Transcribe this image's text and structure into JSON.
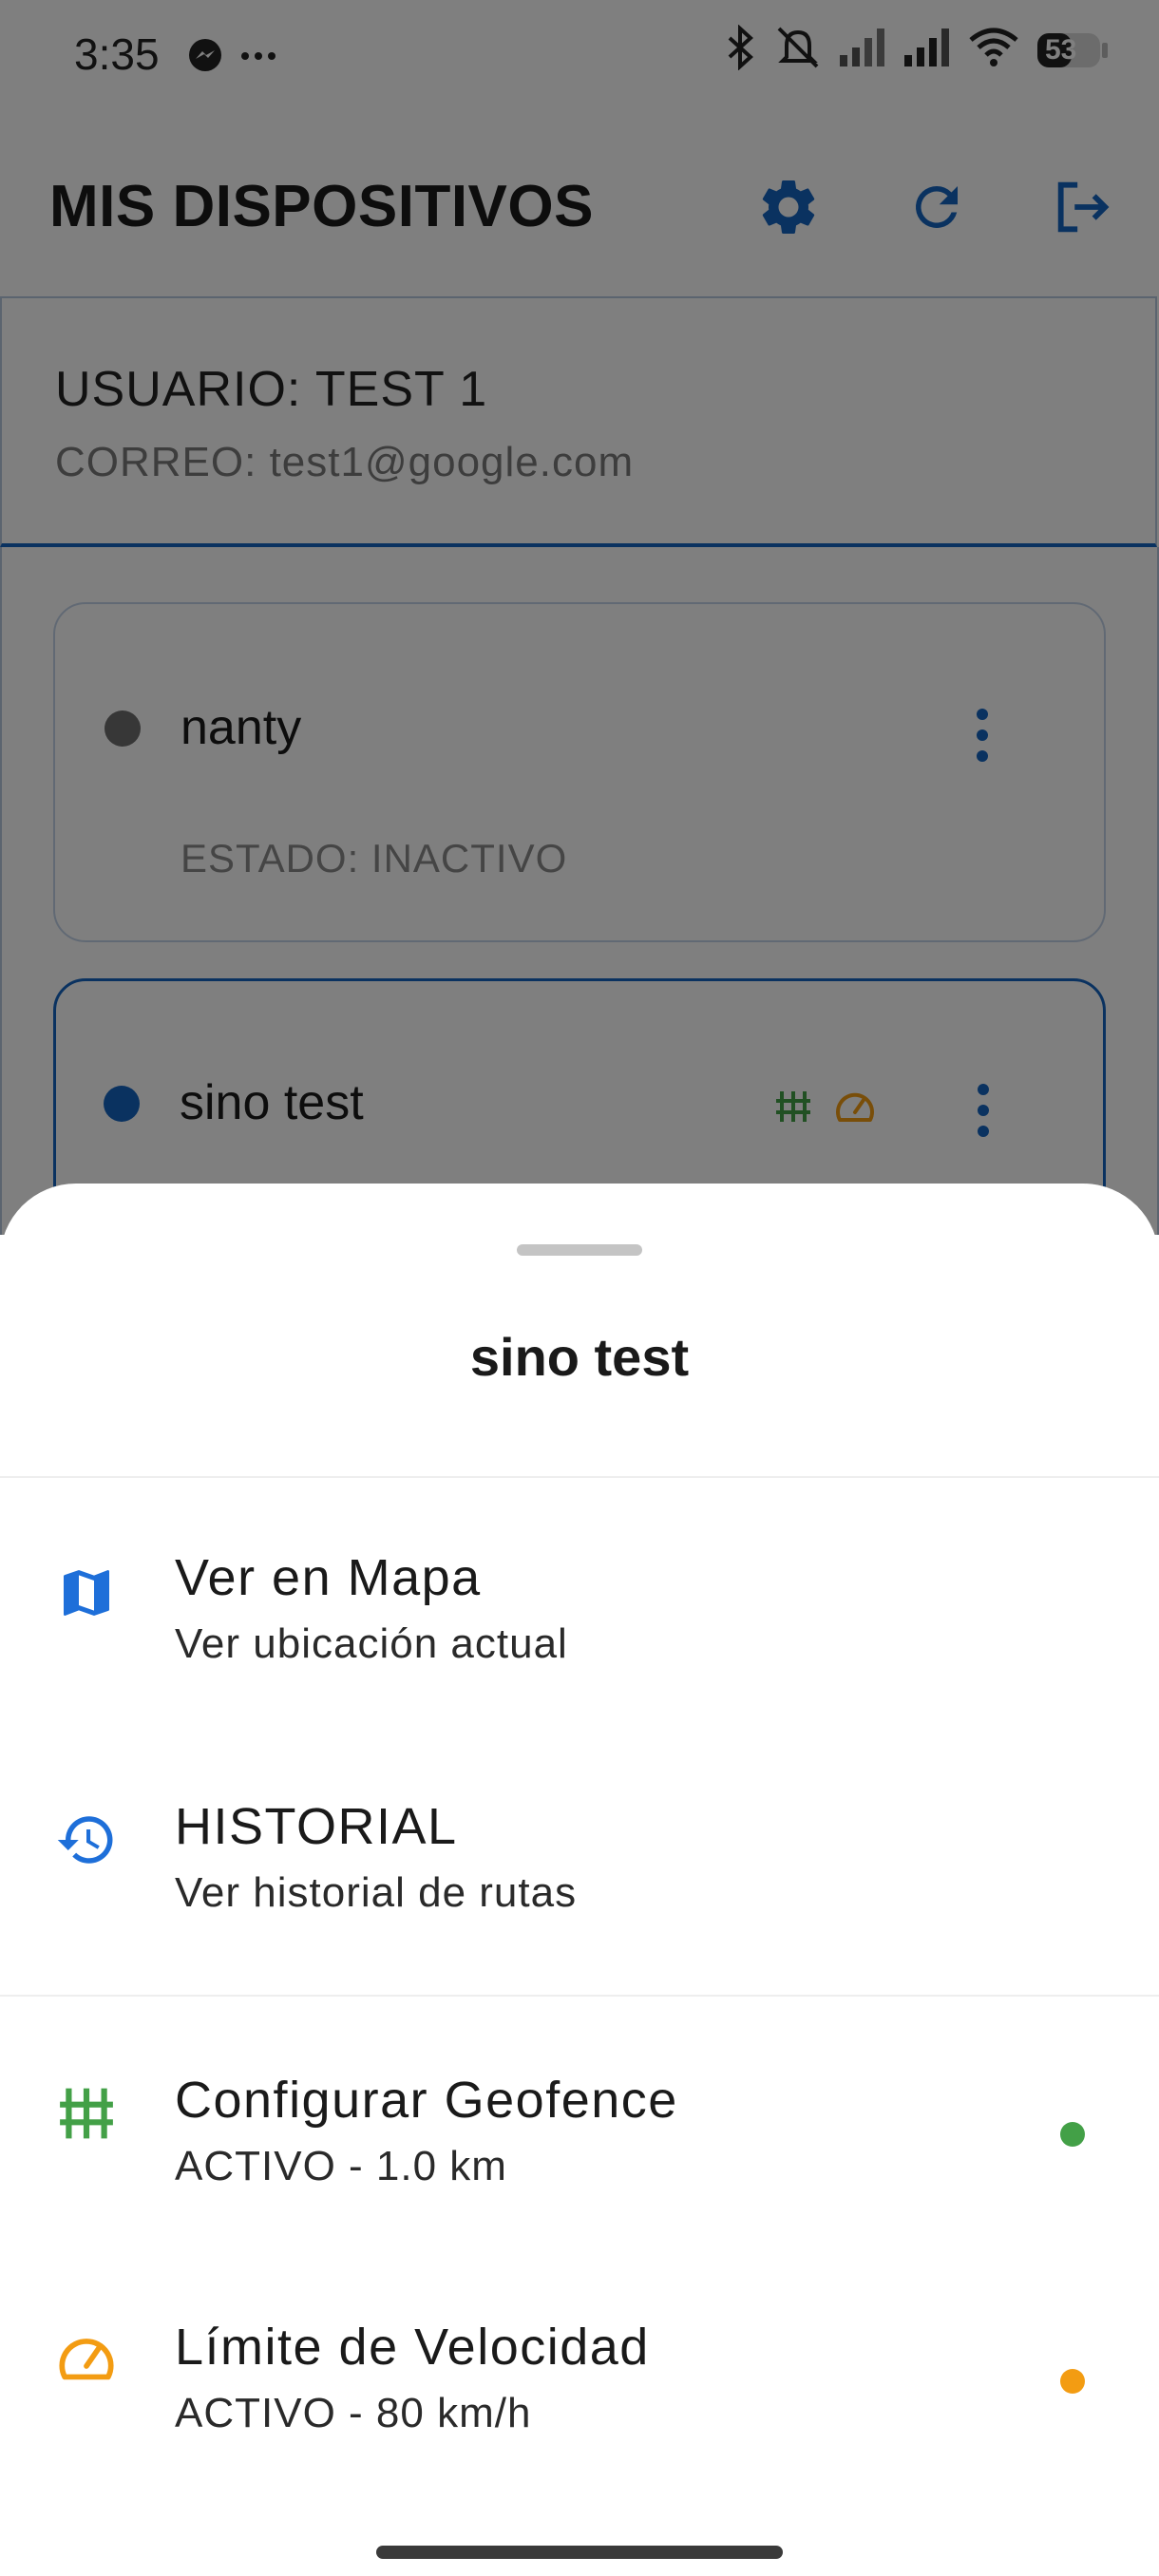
{
  "status_bar": {
    "time": "3:35",
    "battery": "53",
    "icons": [
      "messenger-icon",
      "more-dots-icon",
      "bluetooth-icon",
      "bell-off-icon",
      "signal-icon",
      "signal-icon",
      "wifi-icon",
      "battery-icon"
    ]
  },
  "app_bar": {
    "title": "MIS DISPOSITIVOS",
    "actions": [
      "settings-icon",
      "refresh-icon",
      "logout-icon"
    ],
    "accent_color": "#1565c0"
  },
  "user": {
    "name": "USUARIO: TEST 1",
    "email": "CORREO: test1@google.com"
  },
  "devices": [
    {
      "name": "nanty",
      "state": "ESTADO: INACTIVO",
      "status_color": "#6e6e6e",
      "selected": false
    },
    {
      "name": "sino test",
      "status_color": "#1565c0",
      "selected": true,
      "badges": [
        "fence-icon",
        "speedometer-icon"
      ]
    }
  ],
  "sheet": {
    "title": "sino test",
    "items": [
      {
        "title": "Ver en Mapa",
        "subtitle": "Ver ubicación actual",
        "icon": "map-icon",
        "icon_color": "#1e6fd9"
      },
      {
        "title": "HISTORIAL",
        "subtitle": "Ver historial de rutas",
        "icon": "history-icon",
        "icon_color": "#1e6fd9"
      },
      {
        "title": "Configurar Geofence",
        "subtitle": "ACTIVO - 1.0 km",
        "icon": "fence-icon",
        "icon_color": "#43a047",
        "status_dot": "#43a047"
      },
      {
        "title": "Límite de Velocidad",
        "subtitle": "ACTIVO - 80 km/h",
        "icon": "speedometer-icon",
        "icon_color": "#f39c12",
        "status_dot": "#f39c12"
      }
    ]
  }
}
